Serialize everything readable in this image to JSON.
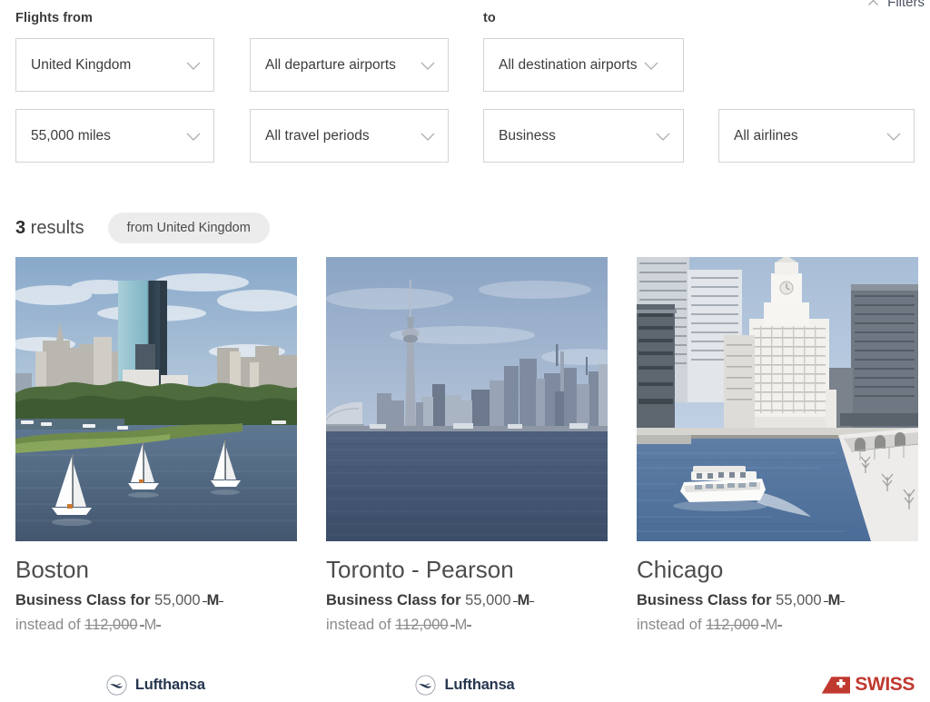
{
  "header": {
    "filters_label": "Filters",
    "filters_caret_icon": "chevron-up-icon"
  },
  "filter_form": {
    "label_from": "Flights from",
    "label_to": "to",
    "chevron_icon": "chevron-down-icon",
    "fields": {
      "origin_country": {
        "value": "United Kingdom"
      },
      "departure_airports": {
        "value": "All departure airports"
      },
      "destination_airports": {
        "value": "All destination airports"
      },
      "miles": {
        "value": "55,000 miles"
      },
      "travel_periods": {
        "value": "All travel periods"
      },
      "cabin_class": {
        "value": "Business"
      },
      "airlines": {
        "value": "All airlines"
      }
    }
  },
  "results": {
    "count": "3",
    "count_suffix": " results",
    "chip_label": "from United Kingdom"
  },
  "cards": [
    {
      "city": "Boston",
      "image_name": "boston-skyline-charles-river-photo",
      "price_prefix": "Business Class for ",
      "price_amount": "55,000",
      "price_unit": "M",
      "instead_prefix": "instead of ",
      "instead_amount": "112,000",
      "instead_unit": "M",
      "airline": {
        "name": "Lufthansa",
        "logo": "lufthansa-logo"
      }
    },
    {
      "city": "Toronto - Pearson",
      "image_name": "toronto-skyline-cn-tower-photo",
      "price_prefix": "Business Class for ",
      "price_amount": "55,000",
      "price_unit": "M",
      "instead_prefix": "instead of ",
      "instead_amount": "112,000",
      "instead_unit": "M",
      "airline": {
        "name": "Lufthansa",
        "logo": "lufthansa-logo"
      }
    },
    {
      "city": "Chicago",
      "image_name": "chicago-river-wrigley-building-photo",
      "price_prefix": "Business Class for ",
      "price_amount": "55,000",
      "price_unit": "M",
      "instead_prefix": "instead of ",
      "instead_amount": "112,000",
      "instead_unit": "M",
      "airline": {
        "name": "SWISS",
        "logo": "swiss-logo"
      }
    }
  ],
  "colors": {
    "text_primary": "#3c3c3c",
    "text_muted": "#8a8a8a",
    "border": "#d3d3d3",
    "chip_bg": "#ececec",
    "lufthansa_navy": "#26364f",
    "swiss_red": "#c0392f"
  }
}
